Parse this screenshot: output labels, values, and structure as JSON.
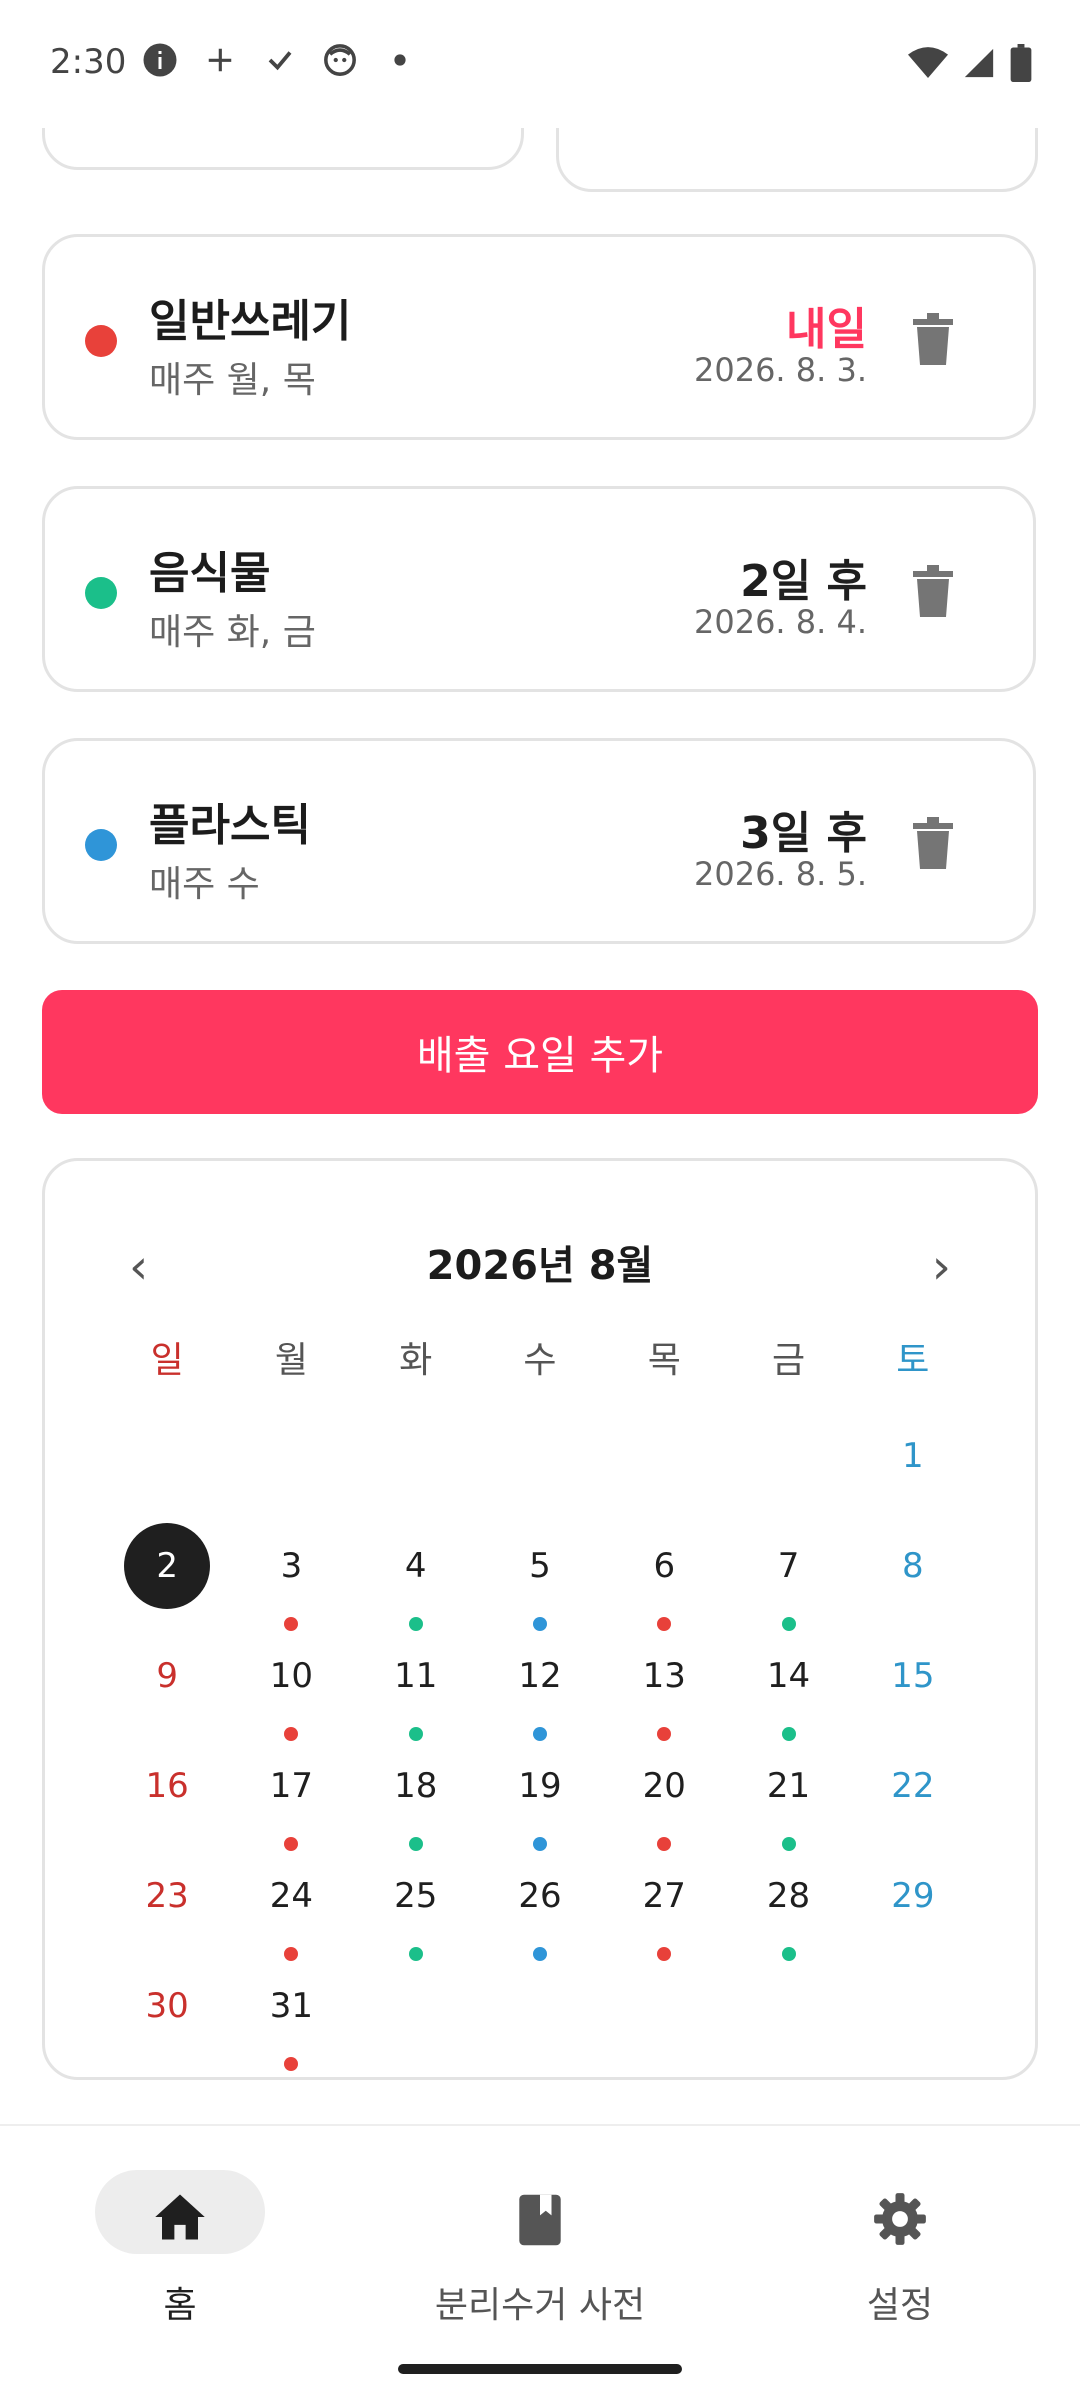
{
  "status_bar": {
    "time": "2:30",
    "icons": [
      "info-icon",
      "plus-icon",
      "check-icon",
      "face-icon",
      "dot-icon"
    ],
    "right_icons": [
      "wifi-icon",
      "signal-icon",
      "battery-icon"
    ]
  },
  "schedules": [
    {
      "name": "일반쓰레기",
      "days": "매주 월, 목",
      "due": "내일",
      "date": "2026. 8. 3.",
      "color": "#e8413a",
      "due_color": "#ff375f"
    },
    {
      "name": "음식물",
      "days": "매주 화, 금",
      "due": "2일 후",
      "date": "2026. 8. 4.",
      "color": "#1bbf8a",
      "due_color": "#1f1f1f"
    },
    {
      "name": "플라스틱",
      "days": "매주 수",
      "due": "3일 후",
      "date": "2026. 8. 5.",
      "color": "#2f95d8",
      "due_color": "#1f1f1f"
    }
  ],
  "add_button": {
    "label": "배출 요일 추가",
    "color": "#ff375f"
  },
  "calendar": {
    "title": "2026년 8월",
    "prev": "‹",
    "next": "›",
    "weekdays": [
      "일",
      "월",
      "화",
      "수",
      "목",
      "금",
      "토"
    ],
    "first_weekday_index": 6,
    "days_in_month": 31,
    "today": 2,
    "markers": {
      "3": "#e8413a",
      "4": "#1bbf8a",
      "5": "#2f95d8",
      "6": "#e8413a",
      "7": "#1bbf8a",
      "10": "#e8413a",
      "11": "#1bbf8a",
      "12": "#2f95d8",
      "13": "#e8413a",
      "14": "#1bbf8a",
      "17": "#e8413a",
      "18": "#1bbf8a",
      "19": "#2f95d8",
      "20": "#e8413a",
      "21": "#1bbf8a",
      "24": "#e8413a",
      "25": "#1bbf8a",
      "26": "#2f95d8",
      "27": "#e8413a",
      "28": "#1bbf8a",
      "31": "#e8413a"
    }
  },
  "nav": [
    {
      "label": "홈",
      "icon": "home-icon",
      "active": true
    },
    {
      "label": "분리수거 사전",
      "icon": "book-icon",
      "active": false
    },
    {
      "label": "설정",
      "icon": "gear-icon",
      "active": false
    }
  ]
}
